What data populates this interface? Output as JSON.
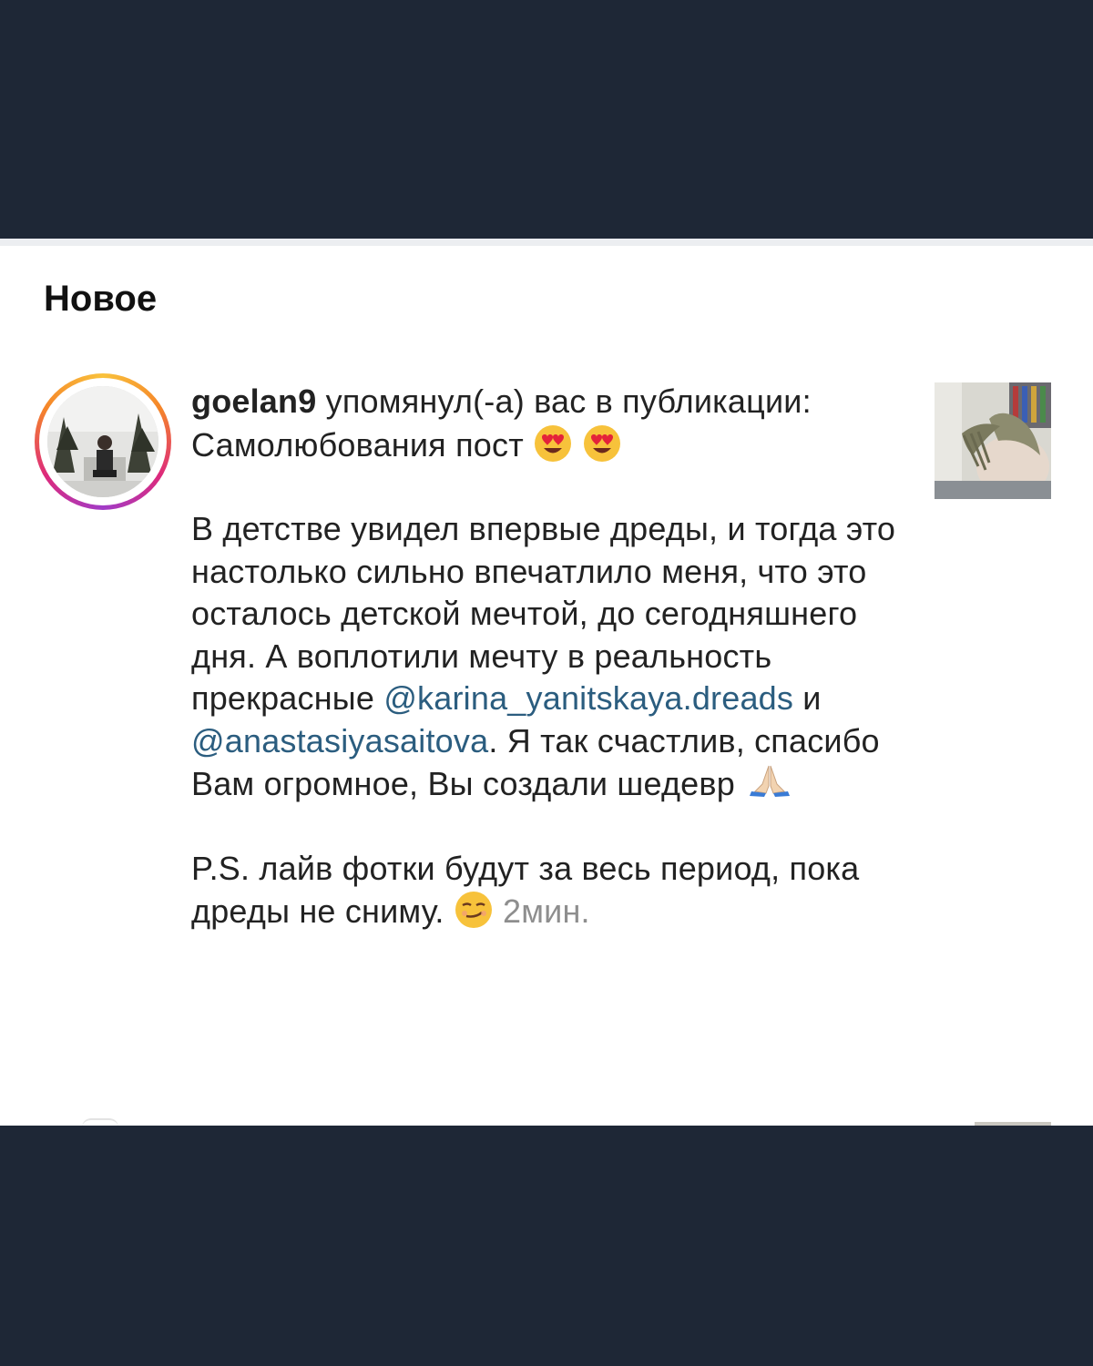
{
  "section": {
    "title": "Новое"
  },
  "notification": {
    "username": "goelan9",
    "action": " упомянул(-а) вас в публикации: ",
    "caption_first": "Самолюбования пост",
    "paragraph2_part1": "В детстве увидел впервые дреды, и тогда это настолько сильно впечатлило меня, что это осталось детской мечтой, до сегодняшнего дня. А воплотили мечту в реальность прекрасные ",
    "mention1": "@karina_yanitskaya.dreads",
    "paragraph2_part2": " и ",
    "mention2": "@anastasiyasaitova",
    "paragraph2_part3": ". Я так счастлив, спасибо Вам огромное, Вы создали шедевр",
    "paragraph3": "P.S. лайв фотки будут за весь период, пока дреды не сниму.",
    "time": "2мин."
  },
  "icons": {
    "heart_eyes": "heart-eyes-emoji",
    "praying_hands": "praying-hands-emoji",
    "smirk": "smirking-face-emoji"
  },
  "colors": {
    "mention": "#2b5d7f",
    "timestamp": "#8e8e8e",
    "outer_background": "#1e2736"
  }
}
